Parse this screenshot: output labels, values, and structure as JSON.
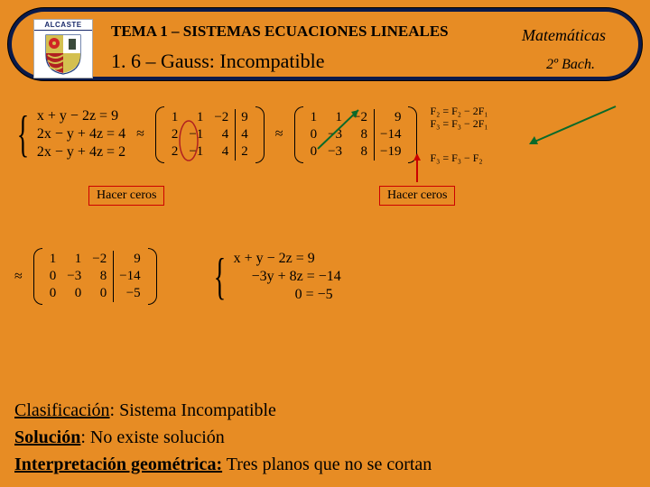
{
  "header": {
    "logo_label": "ALCASTE",
    "tema": "TEMA 1 – SISTEMAS ECUACIONES LINEALES",
    "subtitle": "1. 6 – Gauss: Incompatible",
    "subject": "Matemáticas",
    "level": "2º Bach."
  },
  "step1": {
    "system": [
      "x + y − 2z = 9",
      "2x − y + 4z = 4",
      "2x − y + 4z = 2"
    ],
    "matrix_left": [
      [
        "1",
        "1",
        "−2"
      ],
      [
        "2",
        "−1",
        "4"
      ],
      [
        "2",
        "−1",
        "4"
      ]
    ],
    "matrix_right": [
      "9",
      "4",
      "2"
    ],
    "label": "Hacer ceros"
  },
  "step2": {
    "matrix_left": [
      [
        "1",
        "1",
        "−2"
      ],
      [
        "0",
        "−3",
        "8"
      ],
      [
        "0",
        "−3",
        "8"
      ]
    ],
    "matrix_right": [
      "9",
      "−14",
      "−19"
    ],
    "ops": [
      "F₂ = F₂ − 2F₁",
      "F₃ = F₃ − 2F₁"
    ],
    "op3": "F₃ = F₃ − F₂",
    "label": "Hacer ceros"
  },
  "step3": {
    "matrix_left": [
      [
        "1",
        "1",
        "−2"
      ],
      [
        "0",
        "−3",
        "8"
      ],
      [
        "0",
        "0",
        "0"
      ]
    ],
    "matrix_right": [
      "9",
      "−14",
      "−5"
    ],
    "system": [
      "x + y − 2z = 9",
      "−3y + 8z = −14",
      "0 = −5"
    ]
  },
  "conclusion": {
    "classif_label": "Clasificación",
    "classif_text": ": Sistema Incompatible",
    "sol_label": "Solución",
    "sol_text": ": No existe solución",
    "geom_label": "Interpretación geométrica:",
    "geom_text": " Tres planos que no se cortan"
  }
}
